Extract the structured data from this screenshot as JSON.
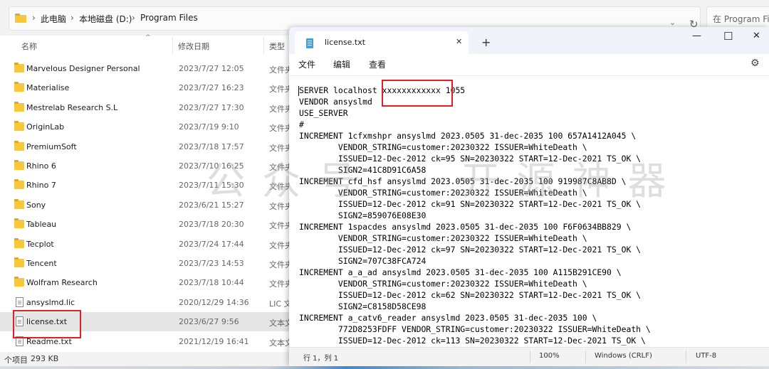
{
  "explorer": {
    "breadcrumb": [
      "此电脑",
      "本地磁盘 (D:)",
      "Program Files"
    ],
    "search_placeholder": "在 Program Files",
    "columns": {
      "name": "名称",
      "date": "修改日期",
      "type": "类型"
    },
    "rows": [
      {
        "name": "Marvelous Designer Personal",
        "date": "2023/7/27 12:05",
        "kind": "文件夹",
        "icon": "folder-icon"
      },
      {
        "name": "Materialise",
        "date": "2023/7/27 16:23",
        "kind": "文件夹",
        "icon": "folder-icon"
      },
      {
        "name": "Mestrelab Research S.L",
        "date": "2023/7/27 17:30",
        "kind": "文件夹",
        "icon": "folder-icon"
      },
      {
        "name": "OriginLab",
        "date": "2023/7/19 9:10",
        "kind": "文件夹",
        "icon": "folder-icon"
      },
      {
        "name": "PremiumSoft",
        "date": "2023/7/18 17:57",
        "kind": "文件夹",
        "icon": "folder-icon"
      },
      {
        "name": "Rhino 6",
        "date": "2023/7/10 16:25",
        "kind": "文件夹",
        "icon": "folder-icon"
      },
      {
        "name": "Rhino 7",
        "date": "2023/7/11 15:30",
        "kind": "文件夹",
        "icon": "folder-icon"
      },
      {
        "name": "Sony",
        "date": "2023/6/21 15:27",
        "kind": "文件夹",
        "icon": "folder-icon"
      },
      {
        "name": "Tableau",
        "date": "2023/7/18 20:30",
        "kind": "文件夹",
        "icon": "folder-icon"
      },
      {
        "name": "Tecplot",
        "date": "2023/7/24 17:44",
        "kind": "文件夹",
        "icon": "folder-icon"
      },
      {
        "name": "Tencent",
        "date": "2023/7/23 14:53",
        "kind": "文件夹",
        "icon": "folder-icon"
      },
      {
        "name": "Wolfram Research",
        "date": "2023/7/18 10:44",
        "kind": "文件夹",
        "icon": "folder-icon"
      },
      {
        "name": "ansyslmd.lic",
        "date": "2020/12/29 14:36",
        "kind": "LIC 文",
        "icon": "file-icon"
      },
      {
        "name": "license.txt",
        "date": "2023/6/27 9:56",
        "kind": "文本文",
        "icon": "file-icon",
        "selected": true
      },
      {
        "name": "Readme.txt",
        "date": "2021/12/19 16:41",
        "kind": "文本文",
        "icon": "file-icon"
      }
    ],
    "status_count": "个项目",
    "status_size": "293 KB"
  },
  "notepad": {
    "tab_title": "license.txt",
    "menu": [
      "文件",
      "编辑",
      "查看"
    ],
    "lines": [
      "SERVER localhost xxxxxxxxxxxx 1055",
      "VENDOR ansyslmd",
      "USE_SERVER",
      "#",
      "INCREMENT 1cfxmshpr ansyslmd 2023.0505 31-dec-2035 100 657A1412A045 \\",
      "        VENDOR_STRING=customer:20230322 ISSUER=WhiteDeath \\",
      "        ISSUED=12-Dec-2012 ck=95 SN=20230322 START=12-Dec-2021 TS_OK \\",
      "        SIGN2=41C8D91C6A58",
      "INCREMENT cfd_hsf ansyslmd 2023.0505 31-dec-2035 100 919987C8AB8D \\",
      "        VENDOR_STRING=customer:20230322 ISSUER=WhiteDeath \\",
      "        ISSUED=12-Dec-2012 ck=91 SN=20230322 START=12-Dec-2021 TS_OK \\",
      "        SIGN2=859076E08E30",
      "INCREMENT 1spacdes ansyslmd 2023.0505 31-dec-2035 100 F6F0634BB829 \\",
      "        VENDOR_STRING=customer:20230322 ISSUER=WhiteDeath \\",
      "        ISSUED=12-Dec-2012 ck=97 SN=20230322 START=12-Dec-2021 TS_OK \\",
      "        SIGN2=707C38FCA724",
      "INCREMENT a_a_ad ansyslmd 2023.0505 31-dec-2035 100 A115B291CE90 \\",
      "        VENDOR_STRING=customer:20230322 ISSUER=WhiteDeath \\",
      "        ISSUED=12-Dec-2012 ck=62 SN=20230322 START=12-Dec-2021 TS_OK \\",
      "        SIGN2=C8158D58CE98",
      "INCREMENT a_catv6_reader ansyslmd 2023.0505 31-dec-2035 100 \\",
      "        772D8253FDFF VENDOR_STRING=customer:20230322 ISSUER=WhiteDeath \\",
      "        ISSUED=12-Dec-2012 ck=113 SN=20230322 START=12-Dec-2021 TS_OK \\"
    ],
    "status": {
      "position": "行 1，列 1",
      "zoom": "100%",
      "line_ending": "Windows (CRLF)",
      "encoding": "UTF-8"
    }
  },
  "watermark": "公众号 · 开源神器",
  "colors": {
    "highlight_red": "#e21d23",
    "folder": "#f8c83c",
    "accent_blue": "#4a9fd8"
  }
}
